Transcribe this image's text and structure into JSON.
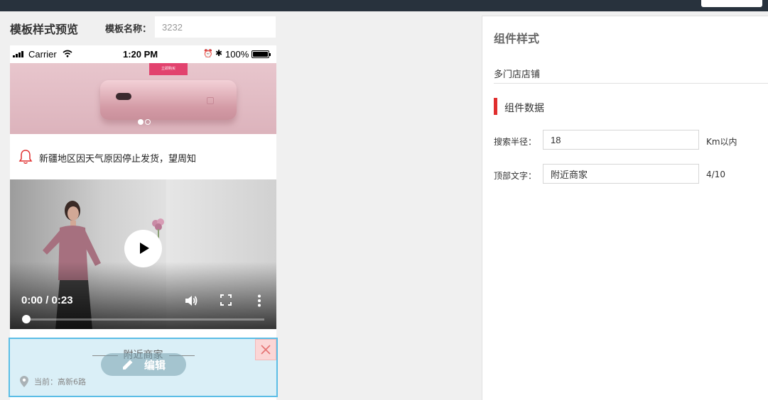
{
  "topbar": {
    "button_label": ""
  },
  "preview": {
    "title": "模板样式预览",
    "name_label": "模板名称：",
    "name_value": "3232"
  },
  "status_bar": {
    "carrier": "Carrier",
    "time": "1:20 PM",
    "alarm": "⏰",
    "bluetooth": "✱",
    "battery_percent": "100%"
  },
  "banner": {
    "tag": "立即购买",
    "slides": 2,
    "active_slide": 1
  },
  "notice": {
    "text": "新疆地区因天气原因停止发货，望周知"
  },
  "video": {
    "time": "0:00 / 0:23",
    "progress": 0
  },
  "nearby": {
    "title": "附近商家",
    "edit_label": "编辑",
    "location": "当前：高新6路"
  },
  "panel": {
    "title": "组件样式",
    "component_name": "多门店店铺",
    "section_title": "组件数据",
    "fields": [
      {
        "label": "搜索半径：",
        "value": "18",
        "suffix": "Km以内"
      },
      {
        "label": "顶部文字：",
        "value": "附近商家",
        "suffix": "4/10"
      }
    ]
  },
  "colors": {
    "accent_red": "#e02e2e",
    "selection_blue": "#5bbde6",
    "topbar": "#28323d"
  }
}
